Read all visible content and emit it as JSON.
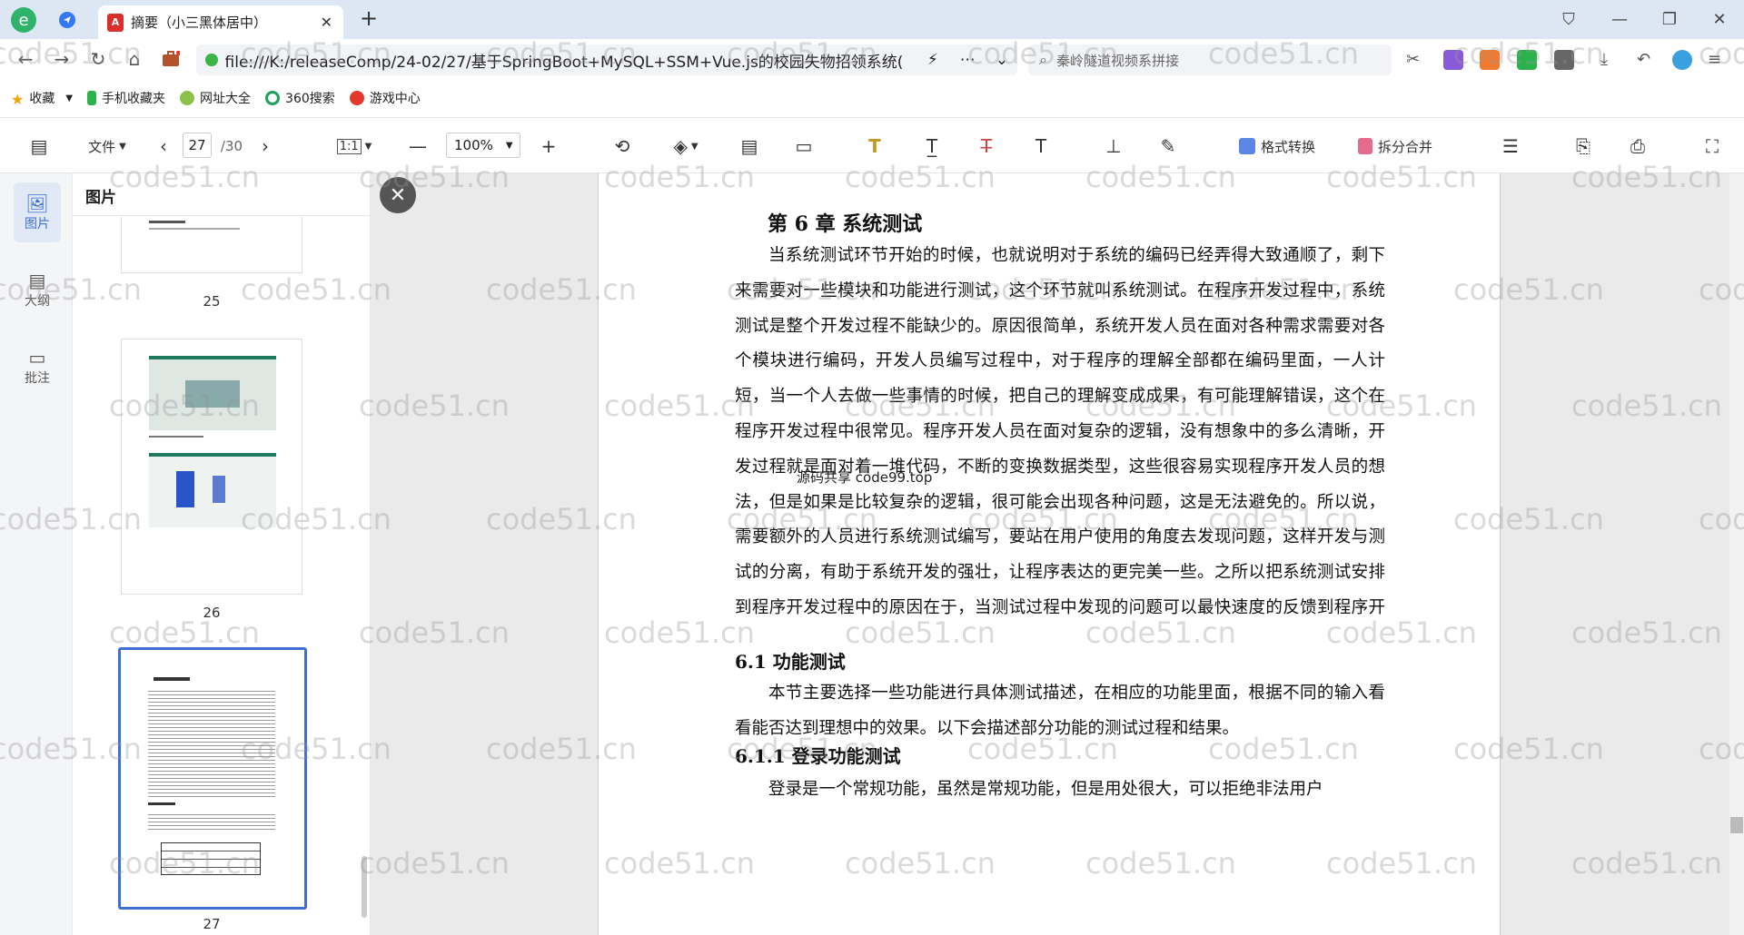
{
  "browser": {
    "tab_title": "摘要（小三黑体居中）",
    "url": "file:///K:/releaseComp/24-02/27/基于SpringBoot+MySQL+SSM+Vue.js的校园失物招领系统(",
    "search_placeholder": "秦岭隧道视频系拼接"
  },
  "bookmarks": [
    "收藏",
    "手机收藏夹",
    "网址大全",
    "360搜索",
    "游戏中心"
  ],
  "pdf_toolbar": {
    "file_label": "文件",
    "current_page": "27",
    "total_pages": "/30",
    "fit_label": "1:1",
    "zoom": "100%",
    "format_convert": "格式转换",
    "split_merge": "拆分合并"
  },
  "rail": {
    "images": "图片",
    "outline": "大纲",
    "comments": "批注"
  },
  "thumbs": {
    "title": "图片",
    "pages": [
      "25",
      "26",
      "27"
    ]
  },
  "document": {
    "chapter_title": "第 6 章  系统测试",
    "para1": "当系统测试环节开始的时候，也就说明对于系统的编码已经弄得大致通顺了，剩下来需要对一些模块和功能进行测试，这个环节就叫系统测试。在程序开发过程中，系统测试是整个开发过程不能缺少的。原因很简单，系统开发人员在面对各种需求需要对各个模块进行编码，开发人员编写过程中，对于程序的理解全部都在编码里面，一人计短，当一个人去做一些事情的时候，把自己的理解变成成果，有可能理解错误，这个在程序开发过程中很常见。程序开发人员在面对复杂的逻辑，没有想象中的多么清晰，开发过程就是面对着一堆代码，不断的变换数据类型，这些很容易实现程序开发人员的想法，但是如果是比较复杂的逻辑，很可能会出现各种问题，这是无法避免的。所以说，需要额外的人员进行系统测试编写，要站在用户使用的角度去发现问题，这样开发与测试的分离，有助于系统开发的强壮，让程序表达的更完美一些。之所以把系统测试安排到程序开发过程中的原因在于，当测试过程中发现的问题可以最快速度的反馈到程序开发人员手里，可以以最快的时间解决问题。所以必须在系统测试环节做好应该做好的事情，让程序开发从开始到结束都有一个完美的流程。",
    "section1": "6.1  功能测试",
    "para2": "本节主要选择一些功能进行具体测试描述，在相应的功能里面，根据不同的输入看看能否达到理想中的效果。以下会描述部分功能的测试过程和结果。",
    "section2": "6.1.1  登录功能测试",
    "para3": "登录是一个常规功能，虽然是常规功能，但是用处很大，可以拒绝非法用户",
    "overlay": "源码共享 code99.top"
  },
  "watermark": "code51.cn"
}
